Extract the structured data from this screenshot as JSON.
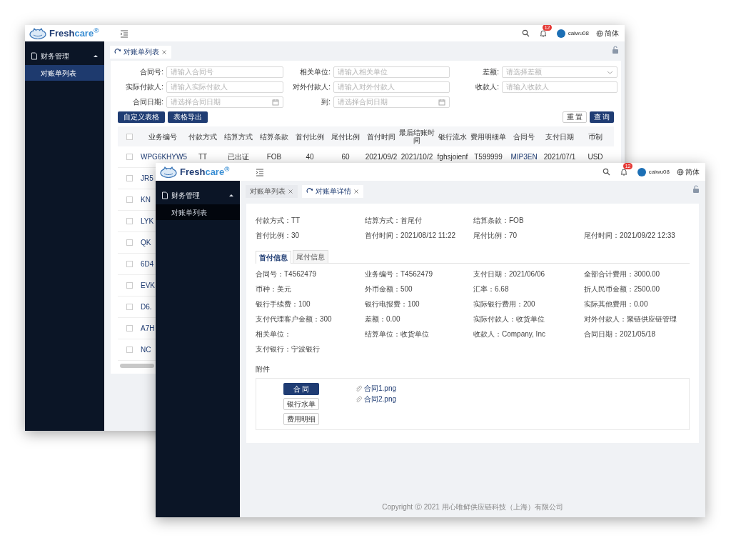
{
  "back_window": {
    "header": {
      "brand": "Fresh",
      "brand_accent": "care$^{®}$",
      "notification_count": "12",
      "user": "caiwu08",
      "language": "简体"
    },
    "sidebar": {
      "group": {
        "label": "财务管理",
        "expanded": true
      },
      "items": [
        {
          "label": "对账单列表",
          "selected": true
        }
      ]
    },
    "tabs": [
      {
        "label": "对账单列表",
        "selected": true
      }
    ],
    "filters": [
      {
        "label": "合同号:",
        "placeholder": "请输入合同号",
        "kind": "text"
      },
      {
        "label": "相关单位:",
        "placeholder": "请输入相关单位",
        "kind": "text"
      },
      {
        "label": "差额:",
        "placeholder": "请选择差额",
        "kind": "select"
      },
      {
        "label": "实际付款人:",
        "placeholder": "请输入实际付款人",
        "kind": "text"
      },
      {
        "label": "对外付款人:",
        "placeholder": "请输入对外付款人",
        "kind": "text"
      },
      {
        "label": "收款人:",
        "placeholder": "请输入收款人",
        "kind": "text"
      },
      {
        "label": "合同日期:",
        "placeholder": "请选择合同日期",
        "kind": "date"
      },
      {
        "label": "到:",
        "placeholder": "请选择合同日期",
        "kind": "date"
      }
    ],
    "left_buttons": [
      "自定义表格",
      "表格导出"
    ],
    "right_buttons": [
      {
        "label": "重 置",
        "primary": false
      },
      {
        "label": "查 询",
        "primary": true
      }
    ],
    "table": {
      "select_all_checked": false,
      "columns": [
        {
          "label": "业务编号",
          "link": true
        },
        {
          "label": "付款方式",
          "link": false
        },
        {
          "label": "结算方式",
          "link": false
        },
        {
          "label": "结算条款",
          "link": false
        },
        {
          "label": "首付比例",
          "link": false
        },
        {
          "label": "尾付比例",
          "link": false
        },
        {
          "label": "首付时间",
          "link": false
        },
        {
          "label": "最后结账时间",
          "link": false
        },
        {
          "label": "银行流水",
          "link": false
        },
        {
          "label": "费用明细单",
          "link": false
        },
        {
          "label": "合同号",
          "link": true
        },
        {
          "label": "支付日期",
          "link": false
        },
        {
          "label": "币制",
          "link": false
        }
      ],
      "rows": [
        {
          "checked": false,
          "cells": [
            "WPG6KHYW5",
            "TT",
            "已出证",
            "FOB",
            "40",
            "60",
            "2021/09/2",
            "2021/10/2",
            "fghsjoienf",
            "T599999",
            "MIP3EN",
            "2021/07/1",
            "USD"
          ]
        },
        {
          "checked": false,
          "cells": [
            "JR5"
          ]
        },
        {
          "checked": false,
          "cells": [
            "KN"
          ]
        },
        {
          "checked": false,
          "cells": [
            "LYK"
          ]
        },
        {
          "checked": false,
          "cells": [
            "QK"
          ]
        },
        {
          "checked": false,
          "cells": [
            "6D4"
          ]
        },
        {
          "checked": false,
          "cells": [
            "EVK"
          ]
        },
        {
          "checked": false,
          "cells": [
            "D6."
          ]
        },
        {
          "checked": false,
          "cells": [
            "A7H"
          ]
        },
        {
          "checked": false,
          "cells": [
            "NC"
          ]
        }
      ]
    }
  },
  "front_window": {
    "header": {
      "brand": "Fresh",
      "brand_accent": "care$^{®}$",
      "notification_count": "12",
      "user": "caiwu08",
      "language": "简体"
    },
    "sidebar": {
      "group": {
        "label": "财务管理",
        "expanded": true
      },
      "items": [
        {
          "label": "对账单列表",
          "selected": false
        }
      ]
    },
    "tabs": [
      {
        "label": "对账单列表",
        "selected": false
      },
      {
        "label": "对账单详情",
        "selected": true
      }
    ],
    "summary": [
      [
        "付款方式：TT",
        "结算方式：首尾付",
        "结算条款：FOB"
      ],
      [
        "首付比例：30",
        "首付时间：2021/08/12 11:22",
        "尾付比例：70",
        "尾付时间：2021/09/22 12:33"
      ]
    ],
    "detail_tabs": [
      {
        "label": "首付信息",
        "selected": true
      },
      {
        "label": "尾付信息",
        "selected": false
      }
    ],
    "details": [
      "合同号：T4562479",
      "业务编号：T4562479",
      "支付日期：2021/06/06",
      "全部合计费用：3000.00",
      "币种：美元",
      "外币金额：500",
      "汇率：6.68",
      "折人民币金额：2500.00",
      "银行手续费：100",
      "银行电报费：100",
      "实际银行费用：200",
      "实际其他费用：0.00",
      "支付代理客户金额：300",
      "差额：0.00",
      "实际付款人：收货单位",
      "对外付款人：聚链供应链管理",
      "相关单位：",
      "结算单位：收货单位",
      "收款人：Company, Inc",
      "合同日期：2021/05/18",
      "支付银行：宁波银行"
    ],
    "attachments_label": "附件",
    "attachment_types": [
      {
        "label": "合 同",
        "selected": true
      },
      {
        "label": "银行水单",
        "selected": false
      },
      {
        "label": "费用明细",
        "selected": false
      }
    ],
    "files": [
      "合同1.png",
      "合同2.png"
    ],
    "copyright": "Copyright Ⓒ 2021 用心唯鲜供应链科技（上海）有限公司"
  }
}
